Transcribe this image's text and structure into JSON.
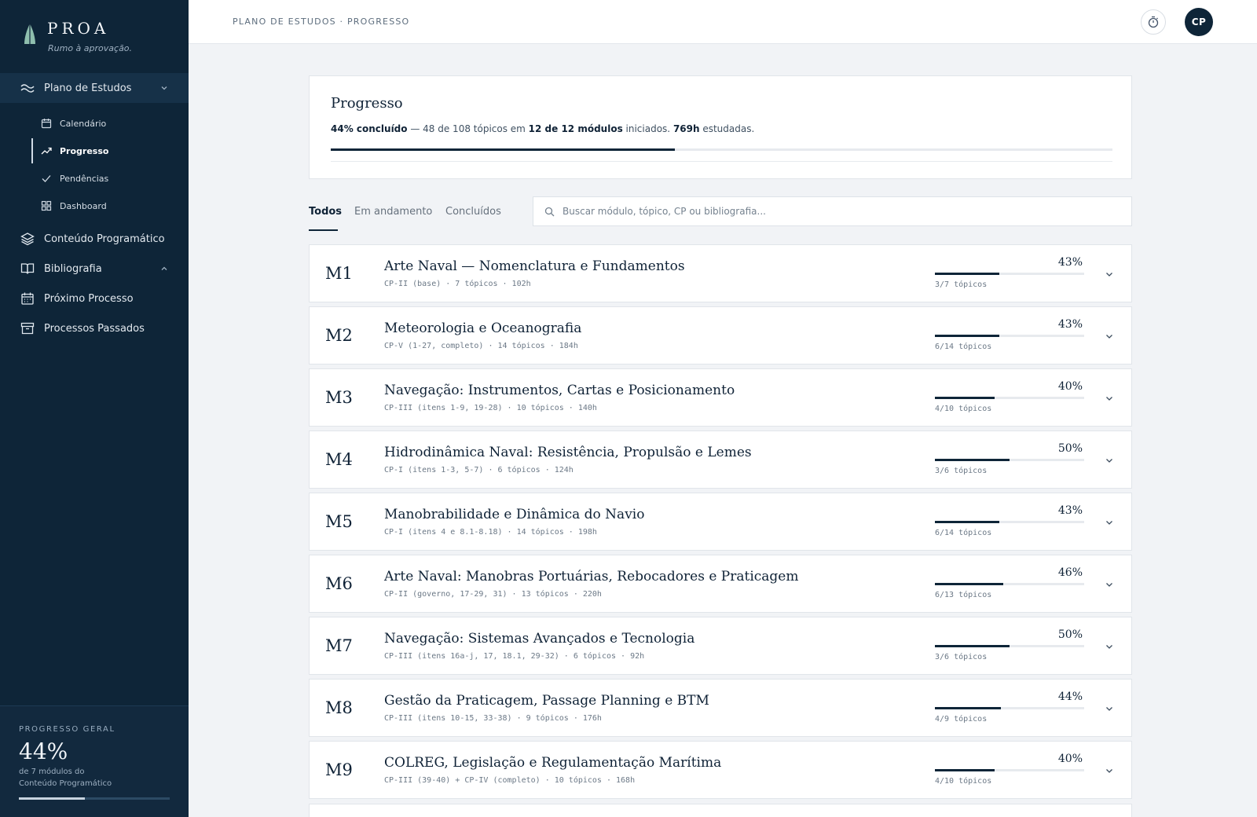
{
  "brand": {
    "name": "PROA",
    "tagline": "Rumo à aprovação."
  },
  "sidebar": {
    "groups": [
      {
        "label": "Plano de Estudos",
        "icon": "waves-icon",
        "expanded": true
      },
      {
        "label": "Conteúdo Programático",
        "icon": "layers-icon"
      },
      {
        "label": "Bibliografia",
        "icon": "book-icon",
        "expanded": true
      },
      {
        "label": "Próximo Processo",
        "icon": "calendar-icon"
      },
      {
        "label": "Processos Passados",
        "icon": "archive-icon"
      }
    ],
    "sub_items": [
      {
        "label": "Calendário",
        "icon": "calendar-icon"
      },
      {
        "label": "Progresso",
        "icon": "trend-up-icon",
        "current": true
      },
      {
        "label": "Pendências",
        "icon": "check-icon"
      },
      {
        "label": "Dashboard",
        "icon": "grid-icon"
      }
    ],
    "footer": {
      "label": "PROGRESSO GERAL",
      "percent_text": "44%",
      "percent": 44,
      "desc_line1": "de 7 módulos do",
      "desc_line2": "Conteúdo Programático"
    }
  },
  "topbar": {
    "breadcrumb": "PLANO DE ESTUDOS · PROGRESSO",
    "timer_icon": "stopwatch-icon",
    "avatar": "CP"
  },
  "summary": {
    "title": "Progresso",
    "pct_text": "44% concluído",
    "text1": " — 48 de 108 tópicos em ",
    "modules_text": "12 de 12 módulos",
    "text2": " iniciados. ",
    "hours_text": "769h",
    "text3": " estudadas.",
    "percent": 44
  },
  "tabs": [
    {
      "label": "Todos",
      "active": true
    },
    {
      "label": "Em andamento"
    },
    {
      "label": "Concluídos"
    }
  ],
  "search": {
    "placeholder": "Buscar módulo, tópico, CP ou bibliografia...",
    "icon": "search-icon"
  },
  "colors": {
    "navy": "#0e2538",
    "accent_logo": "#8fbfae"
  },
  "modules": [
    {
      "code": "M1",
      "title": "Arte Naval — Nomenclatura e Fundamentos",
      "meta": "CP-II (base)  ·  7 tópicos  ·  102h",
      "pct_text": "43%",
      "percent": 43,
      "count": "3/7 tópicos"
    },
    {
      "code": "M2",
      "title": "Meteorologia e Oceanografia",
      "meta": "CP-V (1-27, completo)  ·  14 tópicos  ·  184h",
      "pct_text": "43%",
      "percent": 43,
      "count": "6/14 tópicos"
    },
    {
      "code": "M3",
      "title": "Navegação: Instrumentos, Cartas e Posicionamento",
      "meta": "CP-III (itens 1-9, 19-28)  ·  10 tópicos  ·  140h",
      "pct_text": "40%",
      "percent": 40,
      "count": "4/10 tópicos"
    },
    {
      "code": "M4",
      "title": "Hidrodinâmica Naval: Resistência, Propulsão e Lemes",
      "meta": "CP-I (itens 1-3, 5-7)  ·  6 tópicos  ·  124h",
      "pct_text": "50%",
      "percent": 50,
      "count": "3/6 tópicos"
    },
    {
      "code": "M5",
      "title": "Manobrabilidade e Dinâmica do Navio",
      "meta": "CP-I (itens 4 e 8.1-8.18)  ·  14 tópicos  ·  198h",
      "pct_text": "43%",
      "percent": 43,
      "count": "6/14 tópicos"
    },
    {
      "code": "M6",
      "title": "Arte Naval: Manobras Portuárias, Rebocadores e Praticagem",
      "meta": "CP-II (governo, 17-29, 31)  ·  13 tópicos  ·  220h",
      "pct_text": "46%",
      "percent": 46,
      "count": "6/13 tópicos"
    },
    {
      "code": "M7",
      "title": "Navegação: Sistemas Avançados e Tecnologia",
      "meta": "CP-III (itens 16a-j, 17, 18.1, 29-32)  ·  6 tópicos  ·  92h",
      "pct_text": "50%",
      "percent": 50,
      "count": "3/6 tópicos"
    },
    {
      "code": "M8",
      "title": "Gestão da Praticagem, Passage Planning e BTM",
      "meta": "CP-III (itens 10-15, 33-38)  ·  9 tópicos  ·  176h",
      "pct_text": "44%",
      "percent": 44,
      "count": "4/9 tópicos"
    },
    {
      "code": "M9",
      "title": "COLREG, Legislação e Regulamentação Marítima",
      "meta": "CP-III (39-40) + CP-IV (completo)  ·  10 tópicos  ·  168h",
      "pct_text": "40%",
      "percent": 40,
      "count": "4/10 tópicos"
    }
  ]
}
